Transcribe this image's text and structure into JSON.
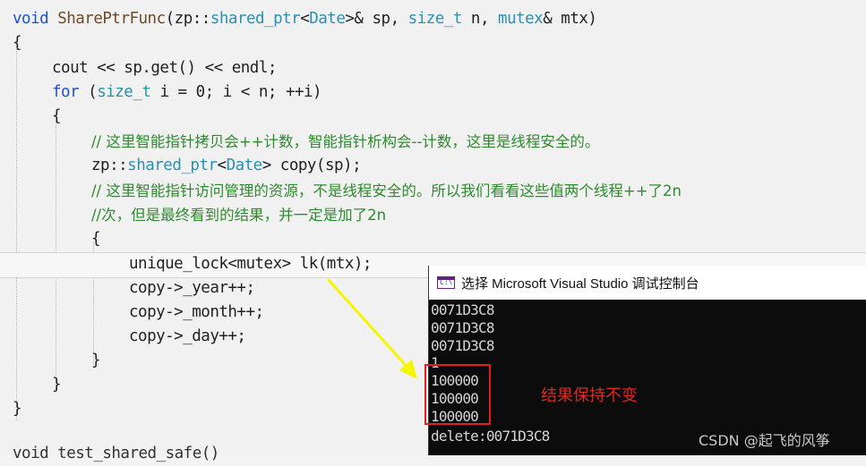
{
  "code": {
    "line_01": {
      "kw": "void",
      "fn": "SharePtrFunc",
      "p1": "(zp::",
      "ty1": "shared_ptr",
      "p2": "<",
      "ty2": "Date",
      "p3": ">& sp, ",
      "ty3": "size_t",
      "p4": " n, ",
      "ty4": "mutex",
      "p5": "& mtx)"
    },
    "line_02": "{",
    "line_03": {
      "a": "cout << sp.get() << endl;"
    },
    "line_04": {
      "kw": "for",
      "p1": " (",
      "ty": "size_t",
      "p2": " i = 0; i < n; ++i)"
    },
    "line_05": "{",
    "line_06": "// 这里智能指针拷贝会++计数，智能指针析构会--计数，这里是线程安全的。",
    "line_07": {
      "p1": "zp::",
      "ty1": "shared_ptr",
      "p2": "<",
      "ty2": "Date",
      "p3": "> copy(sp);"
    },
    "line_08": "// 这里智能指针访问管理的资源，不是线程安全的。所以我们看看这些值两个线程++了2n",
    "line_09": "//次，但是最终看到的结果，并一定是加了2n",
    "line_10": "{",
    "line_11": "unique_lock<mutex> lk(mtx);",
    "line_12": "copy->_year++;",
    "line_13": "copy->_month++;",
    "line_14": "copy->_day++;",
    "line_15": "}",
    "line_16": "}",
    "line_17": "}",
    "line_18": "void test_shared_safe()"
  },
  "console": {
    "title": "选择 Microsoft Visual Studio 调试控制台",
    "icon_text": "C:\\",
    "lines": [
      "0071D3C8",
      "0071D3C8",
      "0071D3C8",
      "1",
      "100000",
      "100000",
      "100000",
      "delete:0071D3C8"
    ]
  },
  "annotation": "结果保持不变",
  "watermark": "CSDN @起飞的风筝",
  "colors": {
    "keyword": "#1f4fd3",
    "type": "#2b91af",
    "comment": "#2e8b2e",
    "annotation": "#e0281e",
    "arrow": "#f5f500"
  }
}
